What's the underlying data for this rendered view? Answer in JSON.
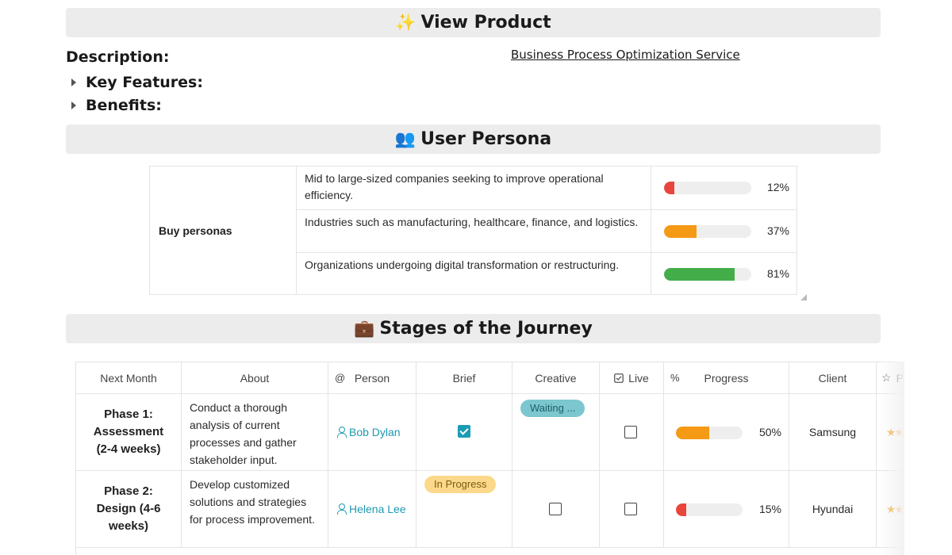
{
  "view_product": {
    "emoji": "✨",
    "title": "View Product"
  },
  "description": {
    "label": "Description:",
    "service_link": "Business Process Optimization Service"
  },
  "toggles": {
    "key_features": "Key Features:",
    "benefits": "Benefits:"
  },
  "user_persona": {
    "emoji": "👥",
    "title": "User Persona"
  },
  "persona_table": {
    "label": "Buy personas",
    "rows": [
      {
        "text": "Mid to large-sized companies seeking to improve operational efficiency.",
        "progress": 12,
        "pct": "12%",
        "color": "#e8453c"
      },
      {
        "text": "Industries such as manufacturing, healthcare, finance, and logistics.",
        "progress": 37,
        "pct": "37%",
        "color": "#f59a14"
      },
      {
        "text": "Organizations undergoing digital transformation or restructuring.",
        "progress": 81,
        "pct": "81%",
        "color": "#43ad4a"
      }
    ]
  },
  "journey": {
    "emoji": "💼",
    "title": "Stages of the Journey",
    "headers": {
      "next_month": "Next Month",
      "about": "About",
      "person_icon": "@",
      "person": "Person",
      "brief": "Brief",
      "creative": "Creative",
      "live": "Live",
      "progress_icon": "%",
      "progress": "Progress",
      "client": "Client",
      "rating_partial": "P"
    },
    "rows": [
      {
        "phase": "Phase 1: Assessment (2-4 weeks)",
        "about": "Conduct a thorough analysis of current processes and gather stakeholder input.",
        "person": "Bob Dylan",
        "brief_checked": true,
        "creative_tag": "Waiting ...",
        "live_checked": false,
        "progress": 50,
        "progress_pct": "50%",
        "progress_color": "#f59a14",
        "client": "Samsung",
        "stars": "★★"
      },
      {
        "phase": "Phase 2: Design (4-6 weeks)",
        "about": "Develop customized solutions and strategies for process improvement.",
        "person": "Helena Lee",
        "brief_tag": "In Progress",
        "brief_checked": false,
        "live_checked": false,
        "progress": 15,
        "progress_pct": "15%",
        "progress_color": "#e8453c",
        "client": "Hyundai",
        "stars": "★★"
      }
    ]
  },
  "colors": {
    "banner_bg": "#ececec",
    "accent_teal": "#1a9cb4",
    "tag_waiting_bg": "#7cc7cf",
    "tag_progress_bg": "#fcd98a"
  }
}
